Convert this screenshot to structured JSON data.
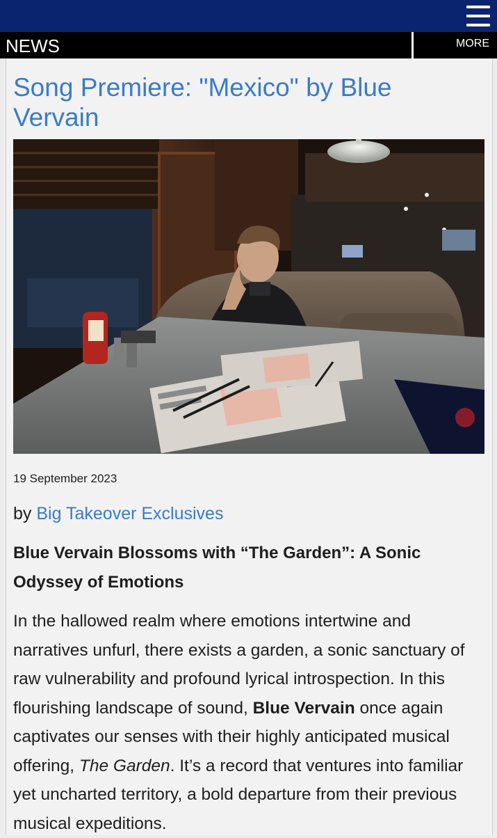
{
  "nav": {
    "section_label": "NEWS",
    "more_label": "MORE",
    "menu_icon": "hamburger-menu-icon"
  },
  "article": {
    "title": "Song Premiere: \"Mexico\" by Blue Vervain",
    "image_subject": "Musician seated at a diner booth table",
    "date": "19 September 2023",
    "by_prefix": "by",
    "author": "Big Takeover Exclusives",
    "subhead": "Blue Vervain Blossoms with “The Garden”: A Sonic Odyssey of Emotions",
    "body_part1": "In the hallowed realm where emotions intertwine and narratives unfurl, there exists a garden, a sonic sanctuary of raw vulnerability and profound lyrical introspection. In this flourishing landscape of sound, ",
    "body_bold": "Blue Vervain",
    "body_part2": " once again captivates our senses with their highly anticipated musical offering, ",
    "body_italic": "The Garden",
    "body_part3": ". It’s a record that ventures into familiar yet uncharted territory, a bold departure from their previous musical expeditions."
  },
  "colors": {
    "topbar": "#0b2470",
    "navbar": "#000000",
    "link": "#3a7bc8",
    "text": "#1e1e1e",
    "page_bg": "#f2f2f3"
  }
}
